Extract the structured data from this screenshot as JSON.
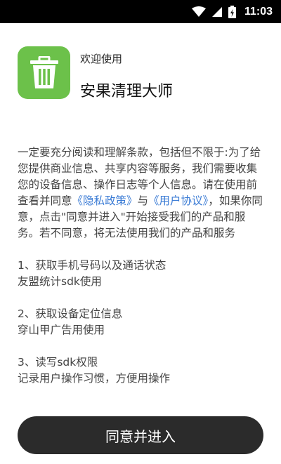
{
  "status_bar": {
    "time": "11:03"
  },
  "header": {
    "welcome": "欢迎使用",
    "app_name": "安果清理大师"
  },
  "terms": {
    "intro_1": "一定要充分阅读和理解条款，包括但不限于:为了给您提供商业信息、共享内容等服务，我们需要收集您的设备信息、操作日志等个人信息。请在使用前查看并同意",
    "privacy_link": "《隐私政策》",
    "connector": "与",
    "user_link": "《用户协议》",
    "intro_2": "，如果你同意，点击\"同意并进入\"开始接受我们的产品和服务。若不同意，将无法使用我们的产品和服务",
    "items": [
      {
        "title": "1、获取手机号码以及通话状态",
        "desc": "友盟统计sdk使用"
      },
      {
        "title": "2、获取设备定位信息",
        "desc": "穿山甲广告用使用"
      },
      {
        "title": "3、读写sdk权限",
        "desc": "记录用户操作习惯，方便用操作"
      }
    ]
  },
  "agree_button": "同意并进入",
  "colors": {
    "icon_bg": "#6cc14a",
    "link": "#3a7bd5",
    "button_bg": "#2b2b2b"
  }
}
